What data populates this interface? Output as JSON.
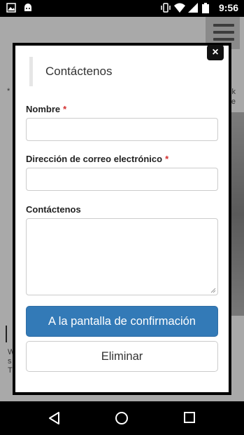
{
  "status_bar": {
    "icons_left": [
      "image-icon",
      "android-icon"
    ],
    "icons_right": [
      "vibrate-icon",
      "wifi-icon",
      "signal-icon",
      "battery-icon"
    ],
    "time": "9:56"
  },
  "modal": {
    "title": "Contáctenos",
    "fields": {
      "name_label": "Nombre",
      "email_label": "Dirección de correo electrónico",
      "message_label": "Contáctenos",
      "required_mark": "*"
    },
    "confirm_button": "A la pantalla de confirmación",
    "delete_button": "Eliminar",
    "close_symbol": "×"
  },
  "background": {
    "left_fragment": "*",
    "right_fragment_1": "k",
    "right_fragment_2": "e",
    "bottom_fragment_1": "W",
    "bottom_fragment_2": "s",
    "bottom_fragment_3": "T"
  },
  "nav_bar": {
    "icons": [
      "back-icon",
      "home-icon",
      "recents-icon"
    ]
  },
  "colors": {
    "primary": "#337ab7",
    "required": "#d32f2f",
    "overlay": "#a9a9a9"
  }
}
